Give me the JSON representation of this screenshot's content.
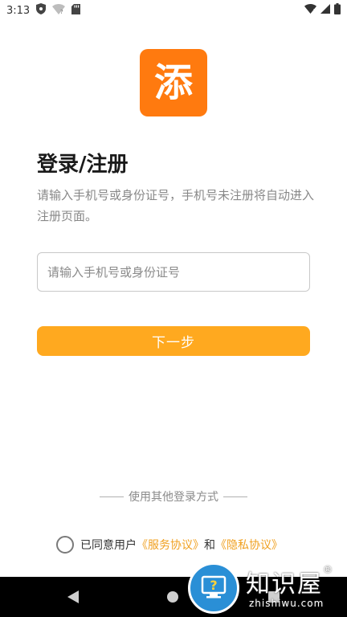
{
  "status_bar": {
    "time": "3:13",
    "icons": [
      "shield-icon",
      "wifi-question-icon",
      "sd-card-icon",
      "wifi-icon",
      "signal-icon",
      "battery-icon"
    ]
  },
  "logo": {
    "char": "添",
    "color": "#ff7a0f"
  },
  "login": {
    "title": "登录/注册",
    "subtitle": "请输入手机号或身份证号，手机号未注册将自动进入注册页面。",
    "input_placeholder": "请输入手机号或身份证号",
    "input_value": "",
    "next_label": "下一步",
    "button_color": "#ffa91f"
  },
  "other_login": {
    "label": "使用其他登录方式"
  },
  "agreement": {
    "prefix": "已同意用户",
    "service_link": "《服务协议》",
    "conjunction": "和",
    "privacy_link": "《隐私协议》",
    "link_color": "#f0a020",
    "checked": false
  },
  "nav_bar": {
    "buttons": [
      "back-icon",
      "home-icon",
      "recents-icon"
    ]
  },
  "watermark": {
    "title": "知识屋",
    "domain": "zhishiwu.com"
  }
}
